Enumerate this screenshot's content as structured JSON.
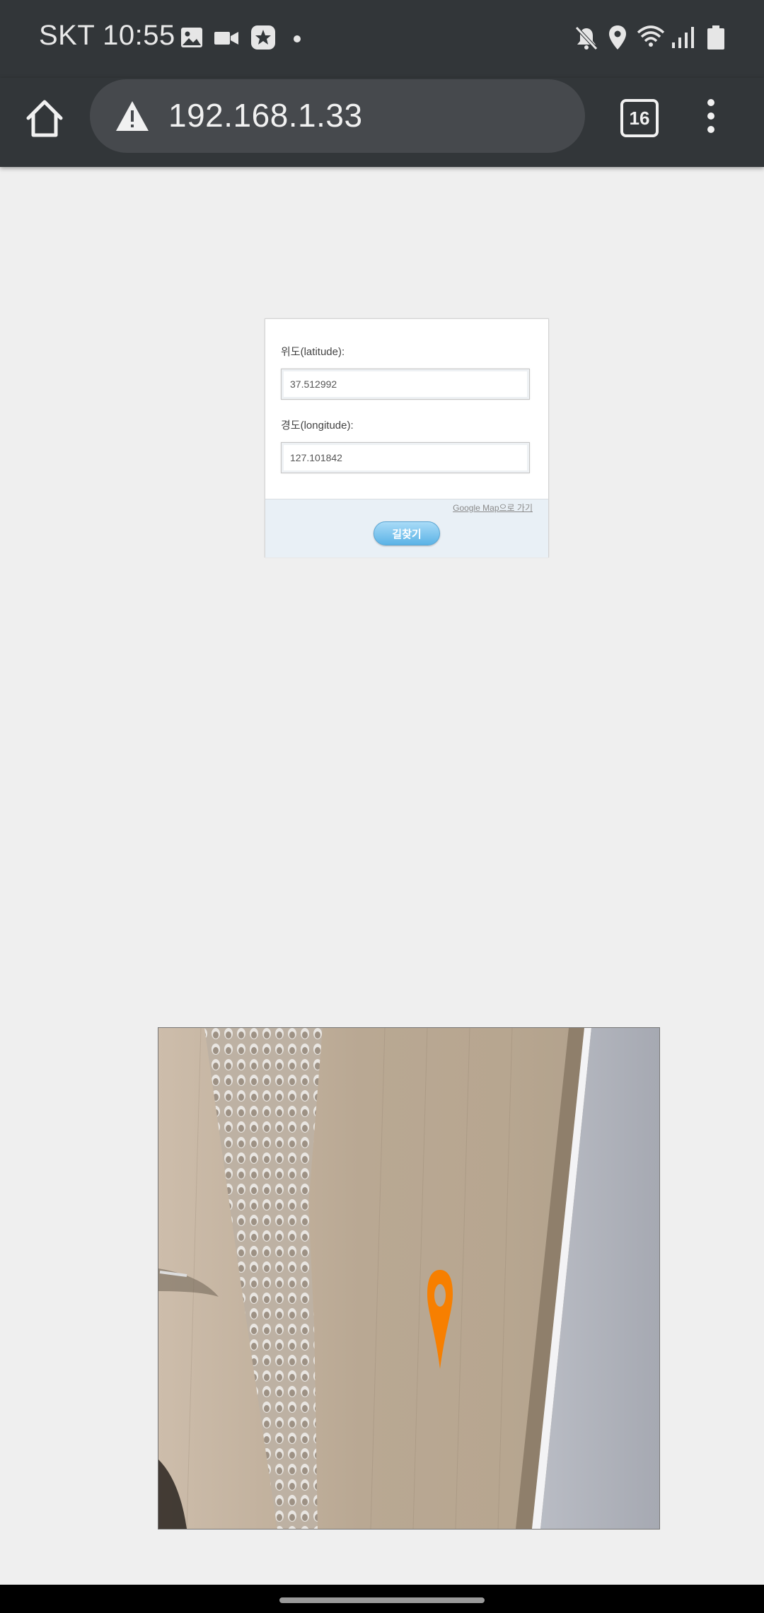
{
  "status_bar": {
    "carrier_time": "SKT 10:55",
    "left_icons": [
      "image-icon",
      "video-camera-icon",
      "star-badge-icon",
      "dot-icon"
    ],
    "right_icons": [
      "mute-icon",
      "location-icon",
      "wifi-icon",
      "signal-icon",
      "battery-icon"
    ]
  },
  "browser": {
    "url": "192.168.1.33",
    "security_icon": "warning-icon",
    "tab_count": "16",
    "toolbar_color": "#323639"
  },
  "form": {
    "latitude_label": "위도(latitude):",
    "latitude_value": "37.512992",
    "longitude_label": "경도(longitude):",
    "longitude_value": "127.101842",
    "google_map_link": "Google Map으로 가기",
    "find_route_button": "길찾기",
    "button_color": "#5bb3e6"
  },
  "camera_view": {
    "pin_icon": "location-pin-icon",
    "pin_color": "#f77f00"
  }
}
